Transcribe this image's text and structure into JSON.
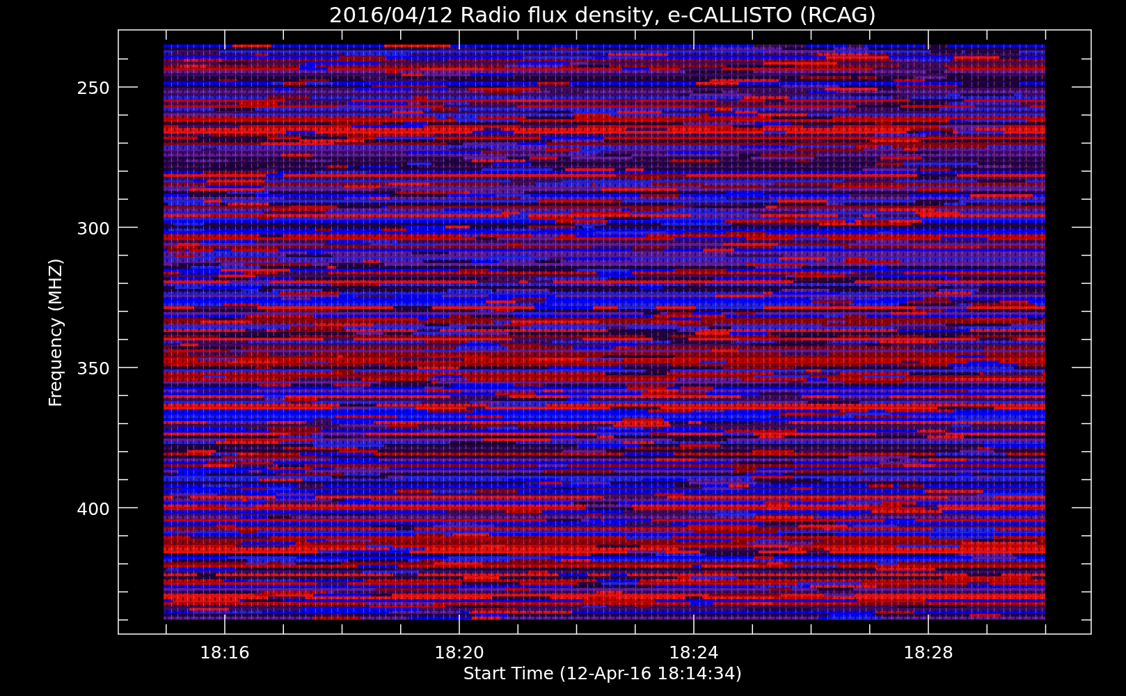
{
  "title": "2016/04/12  Radio flux density, e-CALLISTO (RCAG)",
  "y_axis": {
    "label": "Frequency (MHZ)",
    "ticks": [
      "250",
      "300",
      "350",
      "400"
    ]
  },
  "x_axis": {
    "label": "Start Time (12-Apr-16 18:14:34)",
    "ticks": [
      "18:16",
      "18:20",
      "18:24",
      "18:28"
    ]
  }
}
